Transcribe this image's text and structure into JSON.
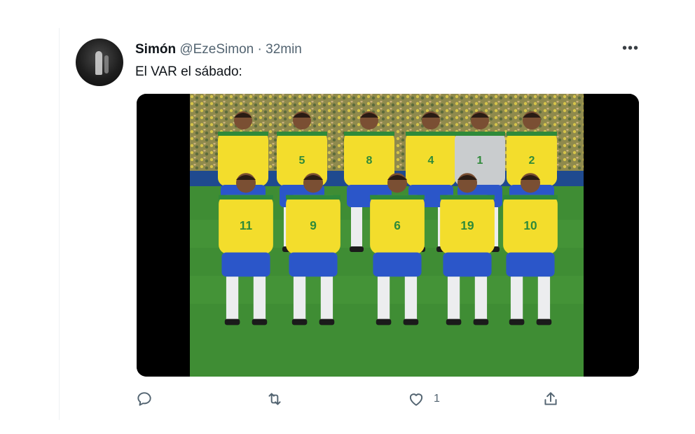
{
  "tweet": {
    "author_name": "Simón",
    "handle": "@EzeSimon",
    "separator": "·",
    "time": "32min",
    "text": "El VAR el sábado:",
    "more_label": "•••"
  },
  "media": {
    "description_icon": "team-photo",
    "jersey_numbers_back": [
      "",
      "5",
      "8",
      "4",
      "1",
      "2"
    ],
    "jersey_numbers_front": [
      "11",
      "9",
      "6",
      "19",
      "10"
    ]
  },
  "actions": {
    "reply_icon": "reply-icon",
    "retweet_icon": "retweet-icon",
    "like_icon": "heart-icon",
    "like_count": "1",
    "share_icon": "share-icon"
  },
  "colors": {
    "jersey_yellow": "#f3dd2c",
    "shorts_blue": "#2b56c9",
    "pitch_green": "#3f8d34",
    "crowd": "#9f9453",
    "keeper_gray": "#c9ccce"
  }
}
